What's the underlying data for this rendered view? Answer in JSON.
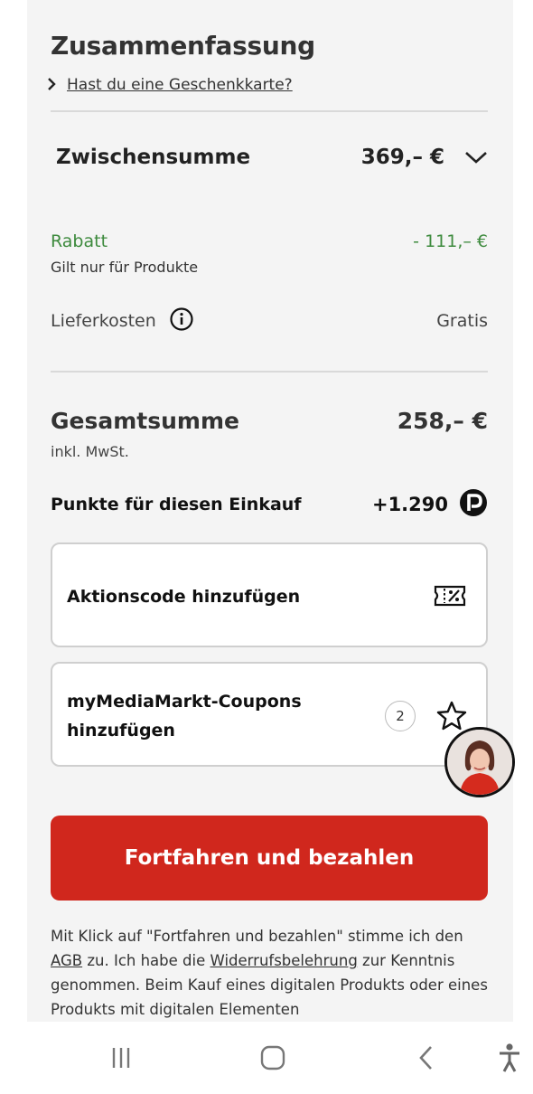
{
  "summary": {
    "title": "Zusammenfassung",
    "gift_card_link": "Hast du eine Geschenkkarte?"
  },
  "subtotal": {
    "label": "Zwischensumme",
    "value": "369,– €"
  },
  "discount": {
    "label": "Rabatt",
    "value": "- 111,– €",
    "note": "Gilt nur für Produkte",
    "color": "#3d8a3d"
  },
  "shipping": {
    "label": "Lieferkosten",
    "value": "Gratis"
  },
  "total": {
    "label": "Gesamtsumme",
    "value": "258,– €",
    "vat_note": "inkl. MwSt."
  },
  "points": {
    "label": "Punkte für diesen Einkauf",
    "value": "+1.290"
  },
  "promo_code": {
    "label": "Aktionscode hinzufügen"
  },
  "coupons": {
    "label_line1": "myMediaMarkt-Coupons",
    "label_line2": "hinzufügen",
    "count": "2"
  },
  "cta": {
    "label": "Fortfahren und bezahlen",
    "color": "#d0271d"
  },
  "legal": {
    "part1": "Mit Klick auf \"Fortfahren und bezahlen\" stimme ich den ",
    "agb_link": "AGB",
    "part2": " zu. Ich habe die ",
    "withdrawal_link": "Widerrufsbelehrung",
    "part3": " zur Kenntnis genommen. Beim Kauf eines digitalen Produkts oder eines Produkts mit digitalen Elementen"
  },
  "icons": {
    "gift_chevron": "chevron-right-icon",
    "subtotal_toggle": "chevron-down-icon",
    "shipping_info": "info-icon",
    "points_logo": "payback-p-icon",
    "promo": "ticket-percent-icon",
    "coupon": "star-outline-icon",
    "nav": [
      "recent-apps-icon",
      "home-icon",
      "back-icon",
      "accessibility-icon"
    ]
  }
}
